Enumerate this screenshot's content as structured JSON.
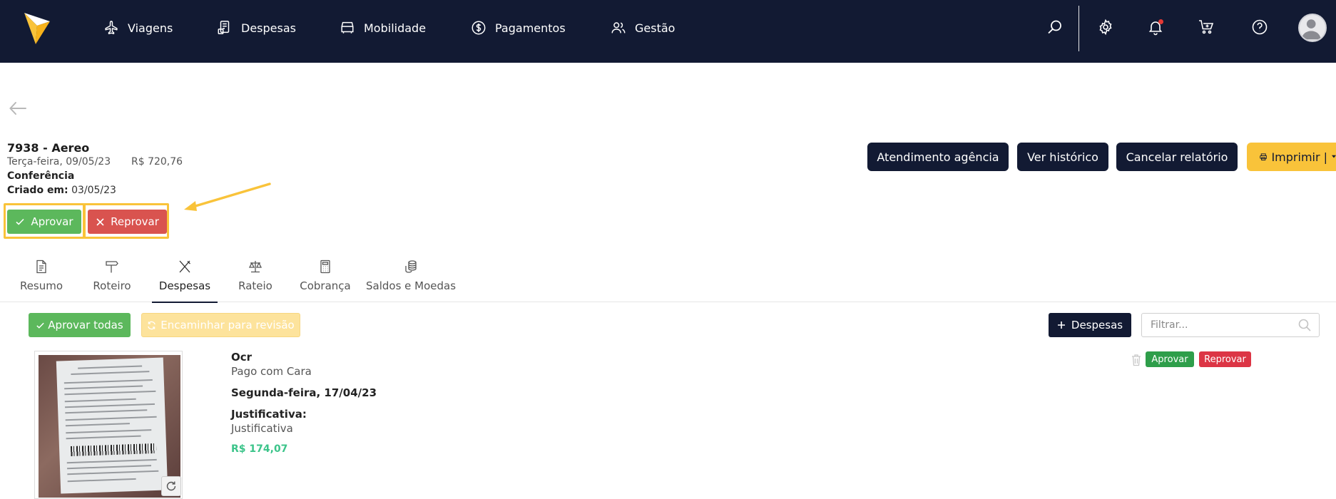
{
  "nav": {
    "items": [
      {
        "label": "Viagens",
        "icon": "airplane-icon"
      },
      {
        "label": "Despesas",
        "icon": "receipt-icon"
      },
      {
        "label": "Mobilidade",
        "icon": "car-icon"
      },
      {
        "label": "Pagamentos",
        "icon": "dollar-circle-icon"
      },
      {
        "label": "Gestão",
        "icon": "users-icon"
      }
    ],
    "right_icons": [
      "search-icon",
      "gear-icon",
      "bell-icon",
      "cart-plus-icon",
      "help-icon",
      "avatar"
    ]
  },
  "report": {
    "title": "7938 - Aereo",
    "date": "Terça-feira, 09/05/23",
    "amount": "R$ 720,76",
    "status": "Conferência",
    "created_label": "Criado em:",
    "created_value": "03/05/23",
    "approve_label": "Aprovar",
    "reject_label": "Reprovar"
  },
  "actions": {
    "atendimento": "Atendimento agência",
    "historico": "Ver histórico",
    "cancelar": "Cancelar relatório",
    "imprimir": "Imprimir |"
  },
  "tabs": [
    {
      "label": "Resumo",
      "icon": "document-icon"
    },
    {
      "label": "Roteiro",
      "icon": "signpost-icon"
    },
    {
      "label": "Despesas",
      "icon": "utensils-icon"
    },
    {
      "label": "Rateio",
      "icon": "scale-icon"
    },
    {
      "label": "Cobrança",
      "icon": "calculator-icon"
    },
    {
      "label": "Saldos e Moedas",
      "icon": "coins-icon"
    }
  ],
  "active_tab": "Despesas",
  "toolbar": {
    "approve_all": "Aprovar todas",
    "forward_review": "Encaminhar para revisão",
    "add_expense": "Despesas",
    "filter_placeholder": "Filtrar..."
  },
  "expense": {
    "title": "Ocr",
    "paid_with": "Pago com Cara",
    "date": "Segunda-feira, 17/04/23",
    "justification_label": "Justificativa:",
    "justification_value": "Justificativa",
    "amount": "R$ 174,07",
    "approve_label": "Aprovar",
    "reject_label": "Reprovar"
  },
  "colors": {
    "navbar": "#121a33",
    "accent_yellow": "#f9c33a",
    "approve_green": "#5cb85c",
    "reject_red": "#d9534f",
    "amount_green": "#3cc48a"
  }
}
